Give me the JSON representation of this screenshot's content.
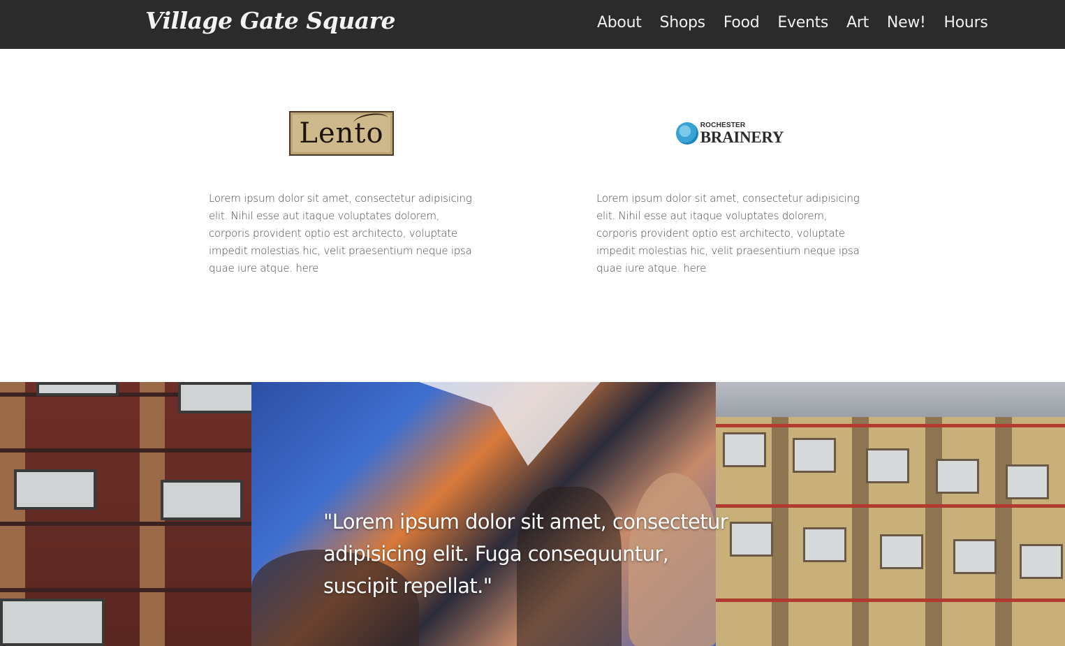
{
  "header": {
    "brand": "Village Gate Square",
    "nav": [
      "About",
      "Shops",
      "Food",
      "Events",
      "Art",
      "New!",
      "Hours"
    ]
  },
  "partners": [
    {
      "logo_text": "Lento",
      "description": "Lorem ipsum dolor sit amet, consectetur adipisicing elit. Nihil esse aut itaque voluptates dolorem, corporis provident optio est architecto, voluptate impedit molestias hic, velit praesentium neque ipsa quae iure atque.",
      "link": "here"
    },
    {
      "logo_small": "ROCHESTER",
      "logo_big": "BRAINERY",
      "description": "Lorem ipsum dolor sit amet, consectetur adipisicing elit. Nihil esse aut itaque voluptates dolorem, corporis provident optio est architecto, voluptate impedit molestias hic, velit praesentium neque ipsa quae iure atque.",
      "link": "here"
    }
  ],
  "hero": {
    "quote": "\"Lorem ipsum dolor sit amet, consectetur adipisicing elit. Fuga consequuntur, suscipit repellat.\""
  }
}
